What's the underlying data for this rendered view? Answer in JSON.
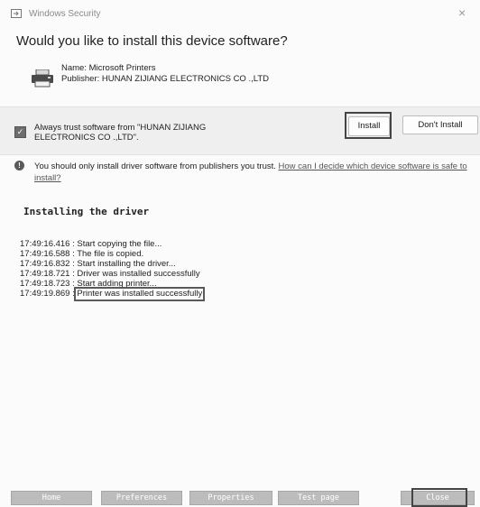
{
  "window": {
    "title": "Windows Security",
    "close_glyph": "×"
  },
  "dialog": {
    "question": "Would you like to install this device software?",
    "device_name": "Name: Microsoft Printers",
    "publisher": "Publisher: HUNAN ZIJIANG ELECTRONICS CO .,LTD",
    "trust_label": "Always trust software from \"HUNAN ZIJIANG ELECTRONICS CO .,LTD\".",
    "trust_checked": true,
    "install_label": "Install",
    "dont_install_label": "Don't Install",
    "warning_text": "You should only install driver software from publishers you trust.",
    "warning_link": "How can I decide which device software is safe to install?"
  },
  "installer": {
    "heading": "Installing the driver",
    "log": [
      "17:49:16.416 : Start copying the file...",
      "17:49:16.588 : The file is copied.",
      "17:49:16.832 : Start installing the driver...",
      "17:49:18.721 : Driver was installed successfully",
      "17:49:18.723 : Start adding printer...",
      "17:49:19.869 : "
    ],
    "last_message": "Printer was installed successfully"
  },
  "toolbar": {
    "home": "Home",
    "preferences": "Preferences",
    "properties": "Properties",
    "test_page": "Test page",
    "close": "Close"
  },
  "icons": {
    "title": "window-security-icon",
    "device": "printer-icon",
    "warning": "exclamation-icon",
    "check": "check-icon"
  },
  "colors": {
    "button_bar": "#bcbcbc",
    "trust_panel": "#efefef"
  }
}
